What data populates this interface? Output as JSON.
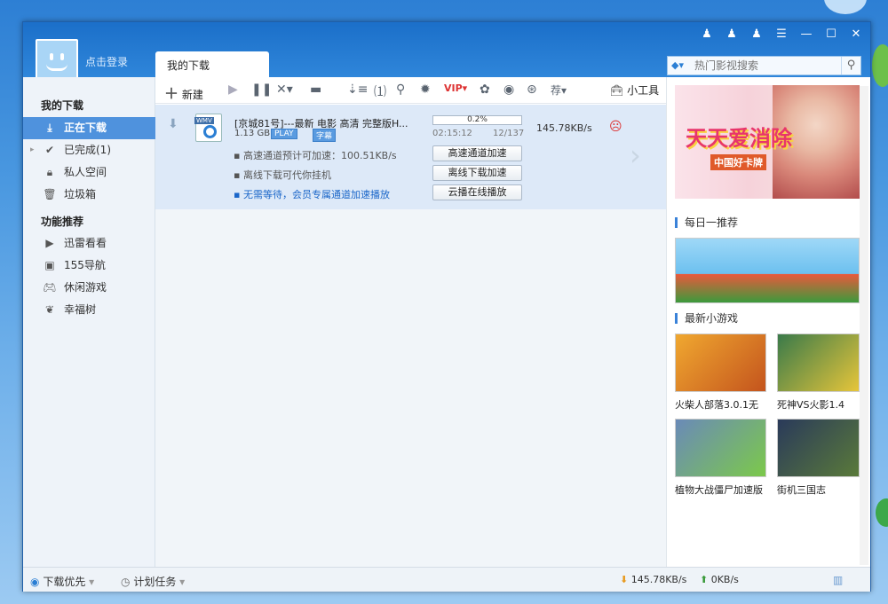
{
  "user": {
    "login": "点击登录"
  },
  "tab": {
    "label": "我的下载"
  },
  "search": {
    "placeholder": "热门影视搜索"
  },
  "toolbar": {
    "new_label": "新建",
    "tools_label": "小工具"
  },
  "sidebar": {
    "header1": "我的下载",
    "items": [
      {
        "label": "正在下载"
      },
      {
        "label": "已完成(1)"
      },
      {
        "label": "私人空间"
      },
      {
        "label": "垃圾箱"
      }
    ],
    "header2": "功能推荐",
    "features": [
      {
        "label": "迅雷看看"
      },
      {
        "label": "155导航"
      },
      {
        "label": "休闲游戏"
      },
      {
        "label": "幸福树"
      }
    ]
  },
  "task": {
    "filetype": "WMV",
    "name": "[京城81号]---最新 电影 高清 完整版H...",
    "size": "1.13 GB",
    "play": "PLAY",
    "subtitle": "字幕",
    "progress_text": "0.2%",
    "progress": 0.002,
    "time": "02:15:12",
    "count": "12/137",
    "speed": "145.78KB/s",
    "hints": [
      "高速通道预计可加速：100.51KB/s",
      "离线下载可代你挂机",
      "无需等待，会员专属通道加速播放"
    ],
    "buttons": [
      "高速通道加速",
      "离线下载加速",
      "云播在线播放"
    ]
  },
  "ads": {
    "banner_logo": "天天爱消除",
    "banner_sub": "中国好卡牌",
    "section1": "每日一推荐",
    "section2": "最新小游戏",
    "games": [
      {
        "title": "火柴人部落3.0.1无"
      },
      {
        "title": "死神VS火影1.4"
      },
      {
        "title": "植物大战僵尸加速版"
      },
      {
        "title": "街机三国志"
      }
    ]
  },
  "status": {
    "priority": "下载优先",
    "schedule": "计划任务",
    "down_speed": "145.78KB/s",
    "up_speed": "0KB/s"
  }
}
